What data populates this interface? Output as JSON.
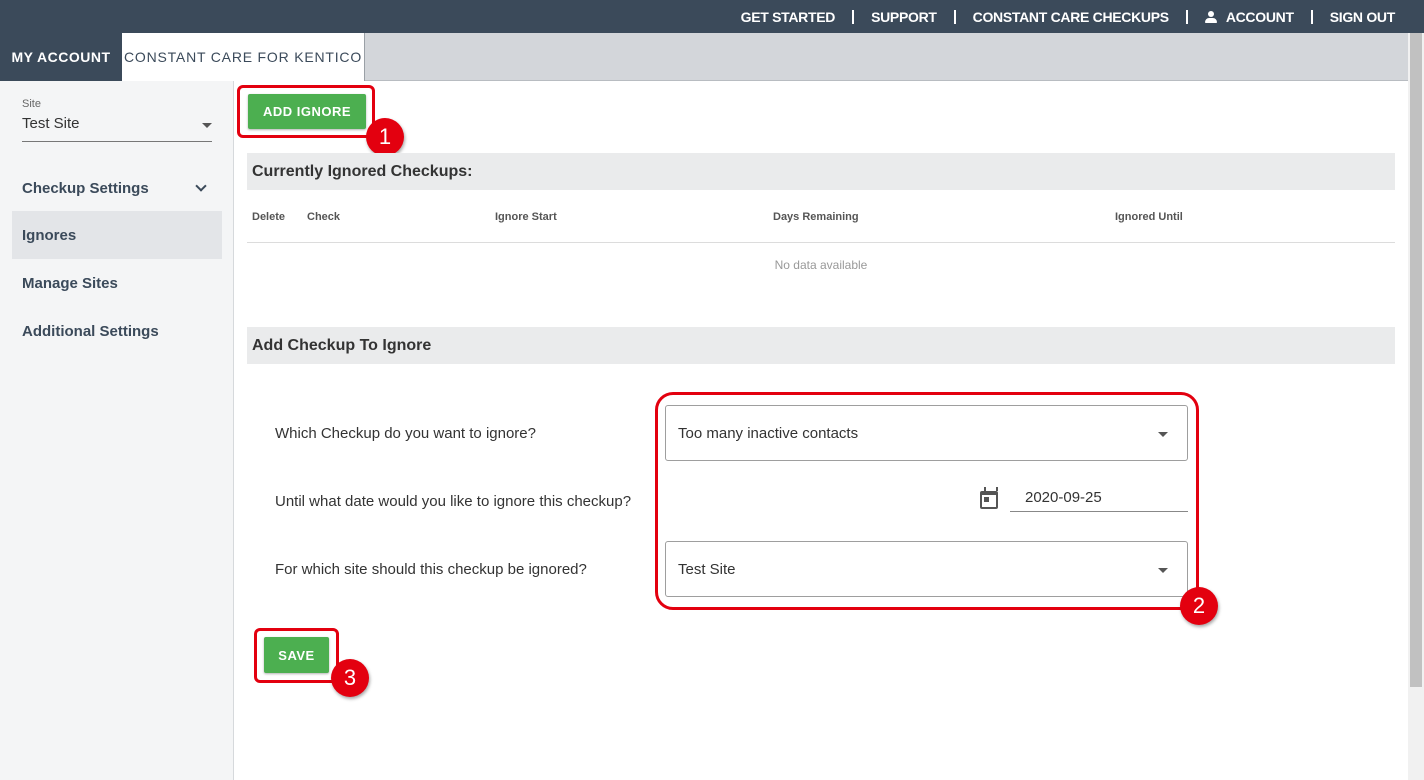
{
  "topnav": {
    "get_started": "GET STARTED",
    "support": "SUPPORT",
    "constant_care_checkups": "CONSTANT CARE CHECKUPS",
    "account": "ACCOUNT",
    "sign_out": "SIGN OUT"
  },
  "tabs": {
    "my_account": "MY ACCOUNT",
    "constant_care": "CONSTANT CARE FOR KENTICO"
  },
  "sidebar": {
    "site_label": "Site",
    "site_value": "Test Site",
    "items": [
      {
        "label": "Checkup Settings"
      },
      {
        "label": "Ignores"
      },
      {
        "label": "Manage Sites"
      },
      {
        "label": "Additional Settings"
      }
    ]
  },
  "main": {
    "add_ignore_label": "ADD IGNORE",
    "ignored_heading": "Currently Ignored Checkups:",
    "columns": [
      "Delete",
      "Check",
      "Ignore Start",
      "Days Remaining",
      "Ignored Until"
    ],
    "no_data": "No data available",
    "add_heading": "Add Checkup To Ignore",
    "q_checkup": "Which Checkup do you want to ignore?",
    "checkup_value": "Too many inactive contacts",
    "q_date": "Until what date would you like to ignore this checkup?",
    "date_value": "2020-09-25",
    "q_site": "For which site should this checkup be ignored?",
    "site_value": "Test Site",
    "save_label": "SAVE"
  },
  "annotations": {
    "badge1": "1",
    "badge2": "2",
    "badge3": "3",
    "color": "#e3000f"
  },
  "colors": {
    "header": "#3b4a5a",
    "button": "#4caf50"
  }
}
